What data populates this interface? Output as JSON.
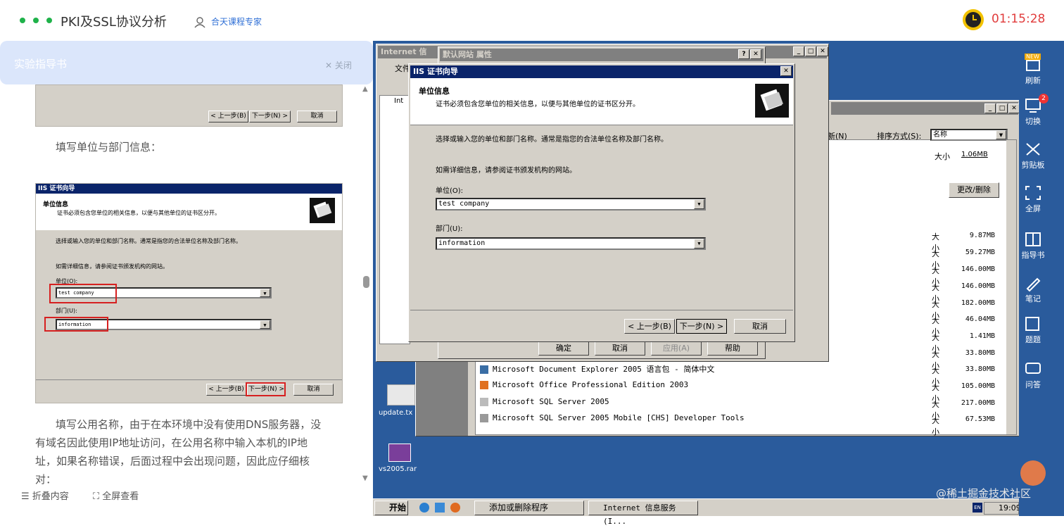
{
  "header": {
    "title": "PKI及SSL协议分析",
    "expert": "合天课程专家",
    "timer": "01:15:28"
  },
  "guide": {
    "tab_label": "实验指导书",
    "close_label": "关闭",
    "para1": "填写单位与部门信息：",
    "para2_lines": [
      "填写公用名称，由于在本环境中没有使用DNS服务器，没",
      "有域名因此使用IP地址访问，在公用名称中输入本机的IP地",
      "址，如果名称错误，后面过程中会出现问题，因此应仔细核",
      "对："
    ],
    "collapse_label": "折叠内容",
    "fullscreen_label": "全屏查看",
    "shot_top": {
      "back": "< 上一步(B)",
      "next": "下一步(N) >",
      "cancel": "取消"
    },
    "shot_main": {
      "title": "IIS 证书向导",
      "heading": "单位信息",
      "desc": "证书必须包含您单位的相关信息，以便与其他单位的证书区分开。",
      "instr": "选择或输入您的单位和部门名称。通常是指您的合法单位名称及部门名称。",
      "detail": "如需详细信息，请参阅证书颁发机构的网站。",
      "org_label": "单位(O):",
      "org_value": "test company",
      "dept_label": "部门(U):",
      "dept_value": "information",
      "back": "< 上一步(B)",
      "next": "下一步(N) >",
      "cancel": "取消"
    }
  },
  "desktop": {
    "iis_window_title": "Internet 信",
    "iis_menu_file": "文件",
    "iis_tree_item": "Int",
    "props_title": "默认网站 属性",
    "props_buttons": {
      "ok": "确定",
      "cancel": "取消",
      "apply": "应用(A)",
      "help": "帮助"
    },
    "wizard": {
      "title": "IIS 证书向导",
      "heading": "单位信息",
      "desc": "证书必须包含您单位的相关信息，以便与其他单位的证书区分开。",
      "instr": "选择或输入您的单位和部门名称。通常是指您的合法单位名称及部门名称。",
      "detail": "如需详细信息，请参阅证书颁发机构的网站。",
      "org_label": "单位(O):",
      "org_value": "test company",
      "dept_label": "部门(U):",
      "dept_value": "information",
      "back": "< 上一步(B)",
      "next": "下一步(N) >",
      "cancel": "取消"
    },
    "addremove": {
      "new_label": "新(N)",
      "sort_label": "排序方式(S):",
      "sort_value": "名称",
      "change_button": "更改/删除",
      "size_label": "大小",
      "top_size": "1.06MB",
      "sizes": [
        "9.87MB",
        "59.27MB",
        "146.00MB",
        "146.00MB",
        "182.00MB",
        "46.04MB",
        "1.41MB",
        "33.80MB",
        "33.80MB",
        "105.00MB",
        "217.00MB",
        "67.53MB"
      ],
      "programs": [
        "Microsoft Document Explorer 2005 语言包 - 简体中文",
        "Microsoft Office Professional Edition 2003",
        "Microsoft SQL Server 2005",
        "Microsoft SQL Server 2005 Mobile [CHS] Developer Tools"
      ]
    },
    "icons": [
      {
        "label": "update.tx"
      },
      {
        "label": "vs2005.rar"
      }
    ]
  },
  "taskbar": {
    "start": "开始",
    "task1": "添加或删除程序",
    "task2": "Internet 信息服务 (I...",
    "tray_en": "EN",
    "time": "19:09"
  },
  "toolbar": {
    "new_badge": "NEW",
    "refresh": "刷新",
    "switch_badge": "2",
    "switch": "切换",
    "clipboard": "剪贴板",
    "fullscreen": "全屏",
    "guide": "指导书",
    "notes": "笔记",
    "quiz": "题题",
    "qa": "问答"
  },
  "watermark": "@稀土掘金技术社区",
  "colors": {
    "accent_green": "#1fb24a",
    "timer_red": "#e13c3c",
    "desktop_blue": "#2a5b9c",
    "win_title_blue": "#0a246a",
    "win_gray": "#d4d0c8"
  }
}
